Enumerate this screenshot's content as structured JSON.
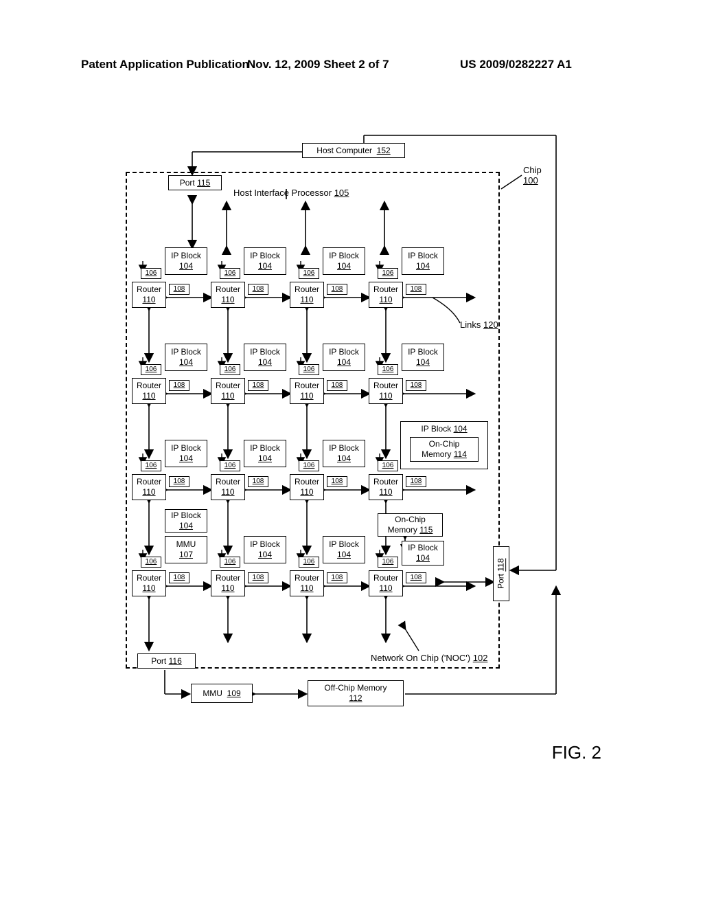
{
  "header": {
    "left": "Patent Application Publication",
    "mid": "Nov. 12, 2009  Sheet 2 of 7",
    "right": "US 2009/0282227 A1"
  },
  "host": {
    "label": "Host Computer",
    "ref": "152"
  },
  "port_top": {
    "label": "Port",
    "ref": "115"
  },
  "hip": {
    "label": "Host Interface Processor",
    "ref": "105"
  },
  "chip": {
    "label": "Chip",
    "ref": "100"
  },
  "links": {
    "label": "Links",
    "ref": "120"
  },
  "ipblock": {
    "label": "IP Block",
    "ref": "104"
  },
  "router": {
    "label": "Router",
    "ref": "110"
  },
  "num106": "106",
  "num108": "108",
  "mmu": {
    "label": "MMU",
    "ref": "107"
  },
  "ocm": {
    "label": "On-Chip",
    "label2": "Memory",
    "ref": "114"
  },
  "ocm2": {
    "label": "On-Chip",
    "label2": "Memory",
    "ref": "115"
  },
  "port_l": {
    "label": "Port",
    "ref": "116"
  },
  "port_r": {
    "label": "Port",
    "ref": "118"
  },
  "noc": {
    "label": "Network On Chip ('NOC')",
    "ref": "102"
  },
  "mmu2": {
    "label": "MMU",
    "ref": "109"
  },
  "offchip": {
    "label": "Off-Chip Memory",
    "ref": "112"
  },
  "fig": "FIG. 2"
}
